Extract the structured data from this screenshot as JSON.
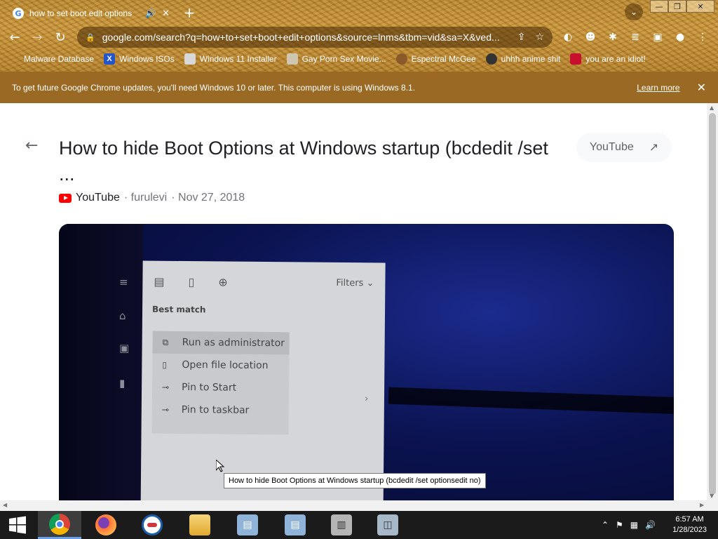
{
  "tab": {
    "title": "how to set boot edit options",
    "audio_icon": "speaker-icon",
    "favicon": "G"
  },
  "window_controls": {
    "minimize": "—",
    "maximize": "❐",
    "close": "✕"
  },
  "omnibox": {
    "url": "google.com/search?q=how+to+set+boot+edit+options&source=lnms&tbm=vid&sa=X&ved..."
  },
  "bookmarks": [
    {
      "label": "Malware Database",
      "icon": ""
    },
    {
      "label": "Windows ISOs",
      "icon": "X"
    },
    {
      "label": "Windows 11 Installer",
      "icon": ""
    },
    {
      "label": "Gay Porn Sex Movie...",
      "icon": ""
    },
    {
      "label": "Espectral McGee",
      "icon": ""
    },
    {
      "label": "uhhh anime shit",
      "icon": ""
    },
    {
      "label": "you are an idiot!",
      "icon": ""
    }
  ],
  "infobar": {
    "message": "To get future Google Chrome updates, you'll need Windows 10 or later. This computer is using Windows 8.1.",
    "learn_more": "Learn more"
  },
  "result": {
    "title": "How to hide Boot Options at Windows startup (bcdedit /set ...",
    "chip_label": "YouTube",
    "source": "YouTube",
    "channel": "· furulevi",
    "date": "· Nov 27, 2018"
  },
  "video": {
    "filters_label": "Filters",
    "best_match": "Best match",
    "context_menu": [
      {
        "label": "Run as administrator",
        "icon": "shield-window-icon"
      },
      {
        "label": "Open file location",
        "icon": "folder-icon"
      },
      {
        "label": "Pin to Start",
        "icon": "pin-icon"
      },
      {
        "label": "Pin to taskbar",
        "icon": "pin-icon"
      }
    ]
  },
  "tooltip": "How to hide Boot Options at Windows startup (bcdedit /set optionsedit no)",
  "taskbar": {
    "time": "6:57 AM",
    "date": "1/28/2023"
  }
}
